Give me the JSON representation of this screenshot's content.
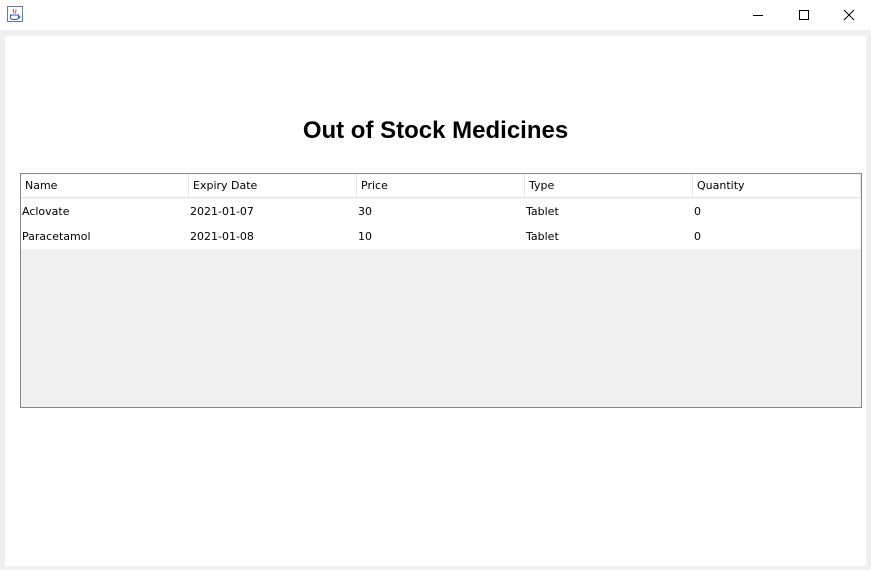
{
  "window": {
    "title": "",
    "icon": "java-icon",
    "controls": [
      "minimize",
      "maximize",
      "close"
    ]
  },
  "heading": "Out of Stock Medicines",
  "table": {
    "columns": [
      "Name",
      "Expiry Date",
      "Price",
      "Type",
      "Quantity"
    ],
    "rows": [
      [
        "Aclovate",
        "2021-01-07",
        "30",
        "Tablet",
        "0"
      ],
      [
        "Paracetamol",
        "2021-01-08",
        "10",
        "Tablet",
        "0"
      ]
    ]
  }
}
